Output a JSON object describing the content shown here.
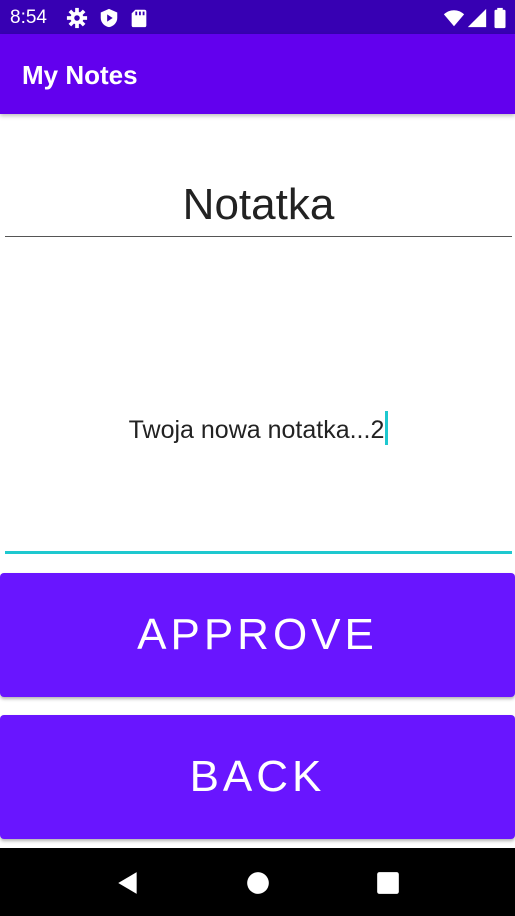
{
  "status_bar": {
    "time": "8:54",
    "icons": [
      "gear-icon",
      "play-protect-icon",
      "sd-card-icon",
      "wifi-icon",
      "signal-icon",
      "battery-icon"
    ]
  },
  "app_bar": {
    "title": "My Notes"
  },
  "note": {
    "title_value": "Notatka",
    "body_value": "Twoja nowa notatka...2"
  },
  "buttons": {
    "approve_label": "APPROVE",
    "back_label": "BACK"
  },
  "nav_bar": {
    "icons": [
      "back-icon",
      "home-icon",
      "recents-icon"
    ]
  },
  "colors": {
    "status_bar": "#3700b3",
    "app_bar": "#6200ee",
    "button": "#6915ff",
    "accent": "#1ec8cf"
  }
}
